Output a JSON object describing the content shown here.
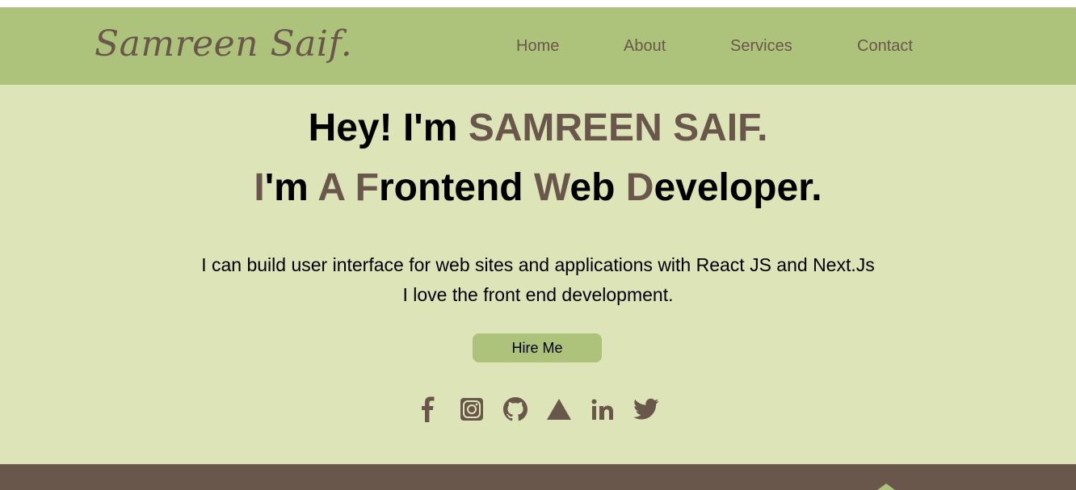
{
  "brand": {
    "logo_text": "Samreen Saif."
  },
  "nav": {
    "items": [
      {
        "label": "Home"
      },
      {
        "label": "About"
      },
      {
        "label": "Services"
      },
      {
        "label": "Contact"
      }
    ]
  },
  "hero": {
    "greeting_prefix": "Hey! I'm ",
    "name": "SAMREEN SAIF.",
    "role_parts": {
      "p1": "I",
      "p2": "'m ",
      "p3": "A",
      "p4": " ",
      "p5": "F",
      "p6": "rontend ",
      "p7": "W",
      "p8": "eb ",
      "p9": "D",
      "p10": "eveloper."
    },
    "description_line1": "I can build user interface for web sites and applications with React JS and Next.Js",
    "description_line2": "I love the front end development.",
    "cta_label": "Hire Me"
  },
  "socials": [
    {
      "icon": "facebook-icon"
    },
    {
      "icon": "instagram-icon"
    },
    {
      "icon": "github-icon"
    },
    {
      "icon": "triangle-icon"
    },
    {
      "icon": "linkedin-icon"
    },
    {
      "icon": "twitter-icon"
    }
  ],
  "colors": {
    "header_bg": "#adc27a",
    "hero_bg": "#dde4b8",
    "accent_brown": "#6a574b",
    "footer_bg": "#6a574b",
    "button_bg": "#adc27a"
  }
}
